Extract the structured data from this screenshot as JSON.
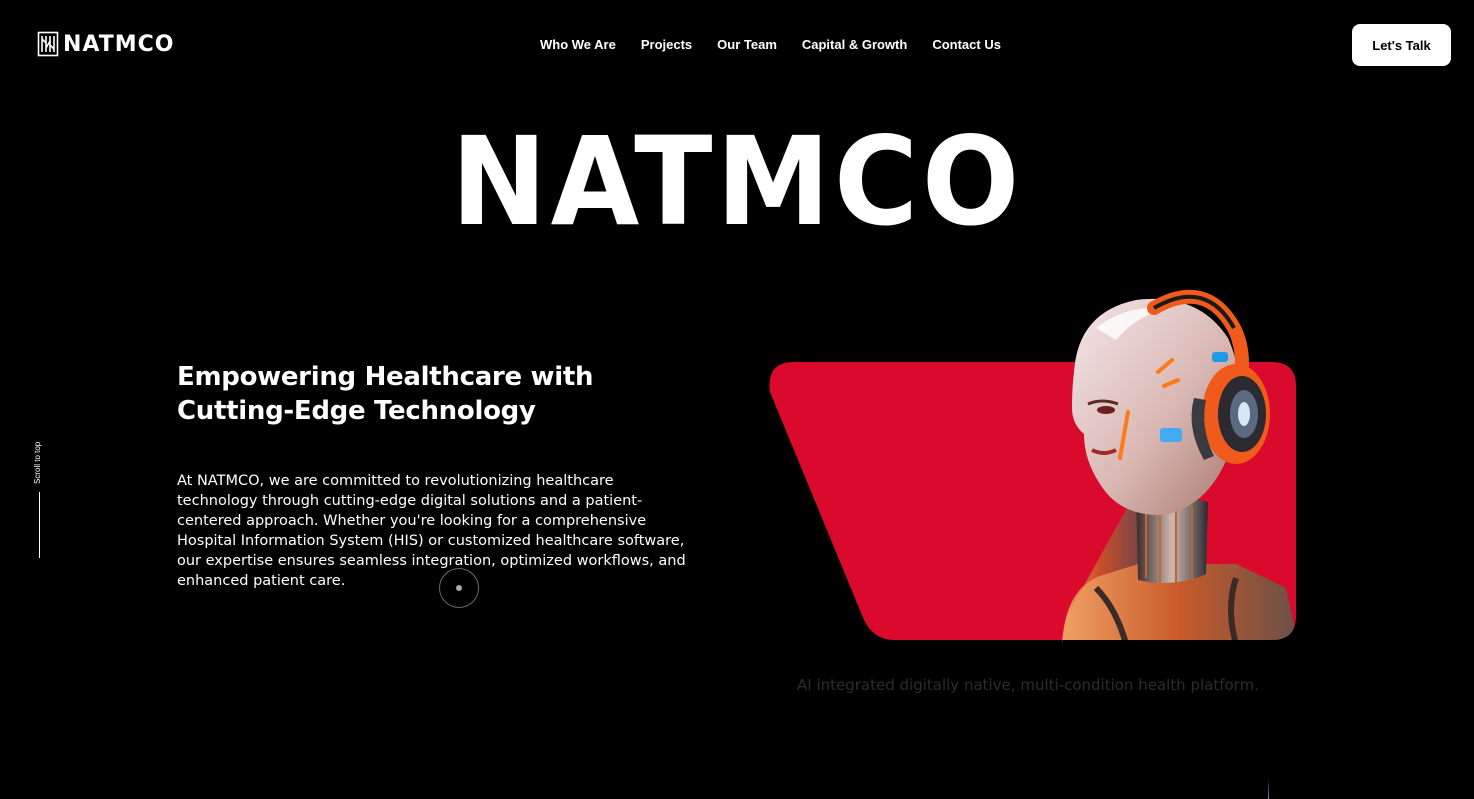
{
  "brand": {
    "logo_text": "NATMCO",
    "hero_wordmark": "NATMCO"
  },
  "nav": {
    "items": [
      {
        "label": "Who We Are"
      },
      {
        "label": "Projects"
      },
      {
        "label": "Our Team"
      },
      {
        "label": "Capital & Growth"
      },
      {
        "label": "Contact Us"
      }
    ],
    "cta_label": "Let's Talk"
  },
  "hero": {
    "heading": "Empowering Healthcare with Cutting-Edge Technology",
    "body": "At NATMCO, we are committed to revolutionizing healthcare technology through cutting-edge digital solutions and a patient-centered approach. Whether you're looking for a comprehensive Hospital Information System (HIS) or customized healthcare software, our expertise ensures seamless integration, optimized workflows, and enhanced patient care.",
    "tagline": "AI integrated digitally native, multi-condition health platform."
  },
  "scroll_top": {
    "label": "Scroll to top"
  },
  "colors": {
    "background": "#000000",
    "accent_red": "#d90a2b",
    "headphone_orange": "#f05a1a",
    "text": "#ffffff",
    "tagline_text": "#2c2c2c"
  },
  "icons": {
    "logo": "natmco-logo-mark-icon",
    "cursor": "cursor-ring-icon"
  }
}
